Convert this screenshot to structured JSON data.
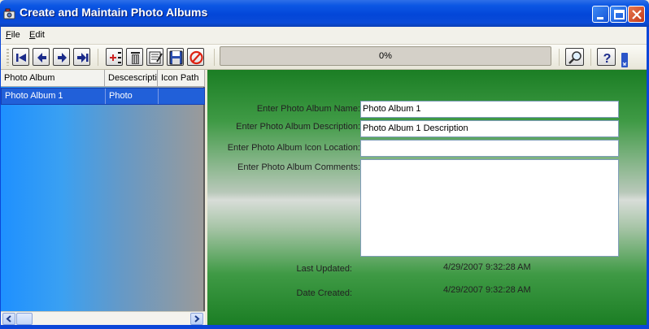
{
  "window": {
    "title": "Create and Maintain Photo Albums",
    "icon": "photo-album-icon"
  },
  "menu": {
    "items": [
      {
        "label": "File",
        "mnemonic": "F",
        "rest": "ile"
      },
      {
        "label": "Edit",
        "mnemonic": "E",
        "rest": "dit"
      }
    ]
  },
  "toolbar": {
    "nav_buttons": [
      "first-record-icon",
      "previous-record-icon",
      "next-record-icon",
      "last-record-icon"
    ],
    "action_buttons": [
      "add-record-icon",
      "delete-record-icon",
      "edit-record-icon",
      "save-icon",
      "cancel-icon"
    ],
    "progress_text": "0%",
    "progress_value": 0,
    "right_buttons": [
      "search-icon",
      "help-icon"
    ]
  },
  "grid": {
    "columns": [
      "Photo Album",
      "Descescripti",
      "Icon Path"
    ],
    "rows": [
      [
        "Photo Album 1",
        "Photo",
        ""
      ]
    ]
  },
  "form": {
    "name_label": "Enter Photo Album Name:",
    "name_value": "Photo Album 1",
    "description_label": "Enter Photo Album Description:",
    "description_value": "Photo Album 1 Description",
    "icon_label": "Enter Photo Album Icon Location:",
    "icon_value": "",
    "comments_label": "Enter Photo Album Comments:",
    "comments_value": "",
    "last_updated_label": "Last Updated:",
    "last_updated_value": "4/29/2007 9:32:28 AM",
    "date_created_label": "Date Created:",
    "date_created_value": "4/29/2007 9:32:28 AM"
  },
  "colors": {
    "titlebar": "#0346d8",
    "selected_row": "#2160d9",
    "panel_green": "#1b7e24"
  }
}
